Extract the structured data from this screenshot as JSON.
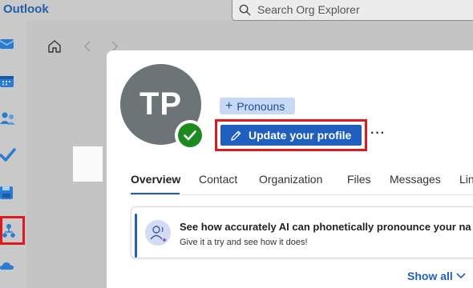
{
  "app": {
    "title": "Outlook"
  },
  "search": {
    "placeholder": "Search Org Explorer"
  },
  "profile": {
    "initials": "TP",
    "presence": "available",
    "pronouns_label": "Pronouns",
    "update_button_label": "Update your profile",
    "more_label": "···"
  },
  "tabs": [
    {
      "label": "Overview",
      "active": true
    },
    {
      "label": "Contact",
      "active": false
    },
    {
      "label": "Organization",
      "active": false
    },
    {
      "label": "Files",
      "active": false
    },
    {
      "label": "Messages",
      "active": false
    },
    {
      "label": "Lin",
      "active": false
    }
  ],
  "banner": {
    "title": "See how accurately AI can phonetically pronounce your na",
    "subtitle": "Give it a try and see how it does!"
  },
  "show_all_label": "Show all",
  "rail_icons": [
    "mail-icon",
    "calendar-icon",
    "people-icon",
    "todo-icon",
    "save-icon",
    "org-explorer-icon",
    "onedrive-icon"
  ],
  "colors": {
    "accent": "#1f5fbf",
    "highlight": "#e0191f",
    "presence": "#1c8a1e"
  }
}
